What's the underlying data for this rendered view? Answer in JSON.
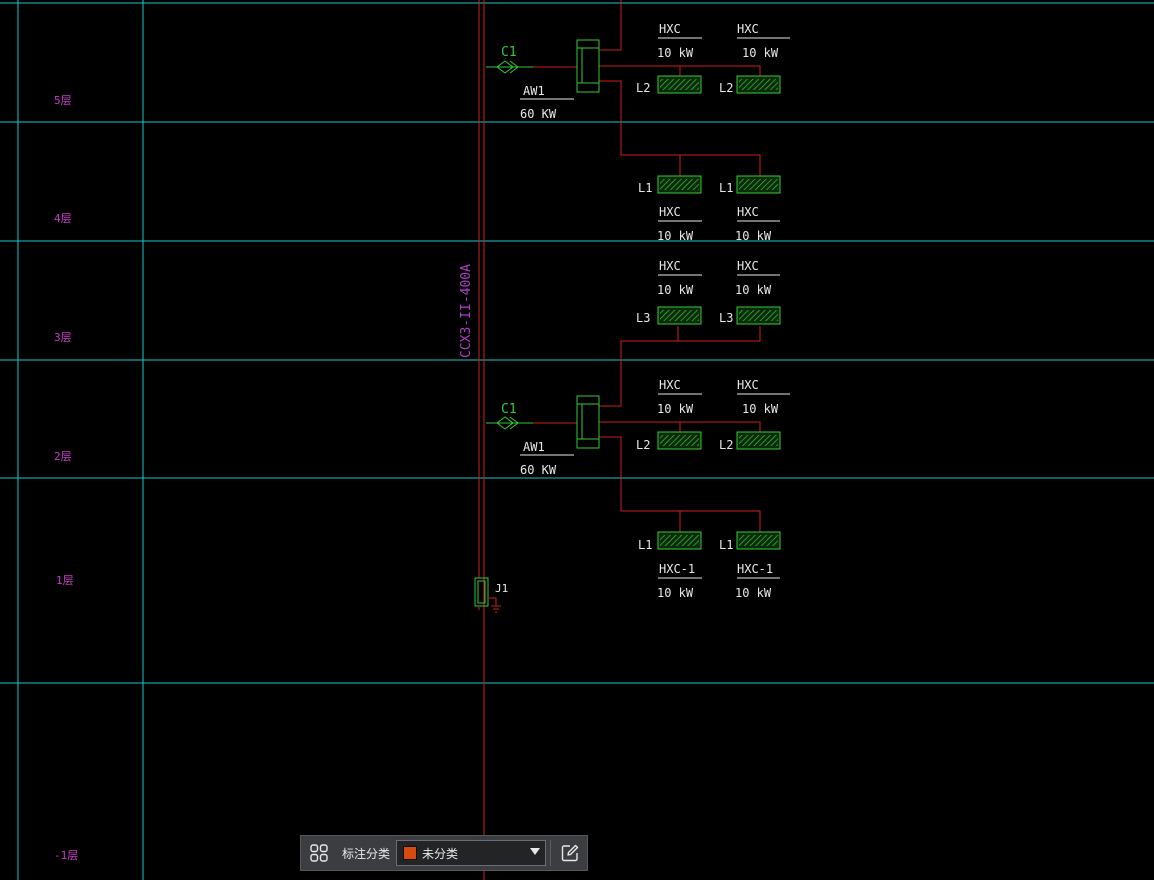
{
  "colors": {
    "background": "#000000",
    "grid": "#19c8c8",
    "wire": "#cc2020",
    "symbol": "#38c838",
    "floor_text": "#c83cc8",
    "label_text": "#e8e8e8",
    "bus_label": "#b040c8",
    "swatch": "#d84a10"
  },
  "floors": [
    {
      "label": "5层"
    },
    {
      "label": "4层"
    },
    {
      "label": "3层"
    },
    {
      "label": "2层"
    },
    {
      "label": "1层"
    },
    {
      "label": "-1层"
    }
  ],
  "busway": {
    "label": "CCX3-II-400A"
  },
  "panels": [
    {
      "breaker": "C1",
      "name": "AW1",
      "power": "60 KW"
    },
    {
      "breaker": "C1",
      "name": "AW1",
      "power": "60 KW"
    }
  ],
  "units": [
    {
      "line": "L2",
      "name": "HXC",
      "power": "10 kW"
    },
    {
      "line": "L2",
      "name": "HXC",
      "power": "10 kW"
    },
    {
      "line": "L1",
      "name": "HXC",
      "power": "10 kW"
    },
    {
      "line": "L1",
      "name": "HXC",
      "power": "10 kW"
    },
    {
      "line": "L3",
      "name": "HXC",
      "power": "10 kW"
    },
    {
      "line": "L3",
      "name": "HXC",
      "power": "10 kW"
    },
    {
      "line": "L2",
      "name": "HXC",
      "power": "10 kW"
    },
    {
      "line": "L2",
      "name": "HXC",
      "power": "10 kW"
    },
    {
      "line": "L1",
      "name": "HXC-1",
      "power": "10 kW"
    },
    {
      "line": "L1",
      "name": "HXC-1",
      "power": "10 kW"
    }
  ],
  "junction": {
    "label": "J1"
  },
  "toolbar": {
    "icon": "grid-apps-icon",
    "label": "标注分类",
    "selected": "未分类",
    "edit_icon": "edit-icon"
  }
}
